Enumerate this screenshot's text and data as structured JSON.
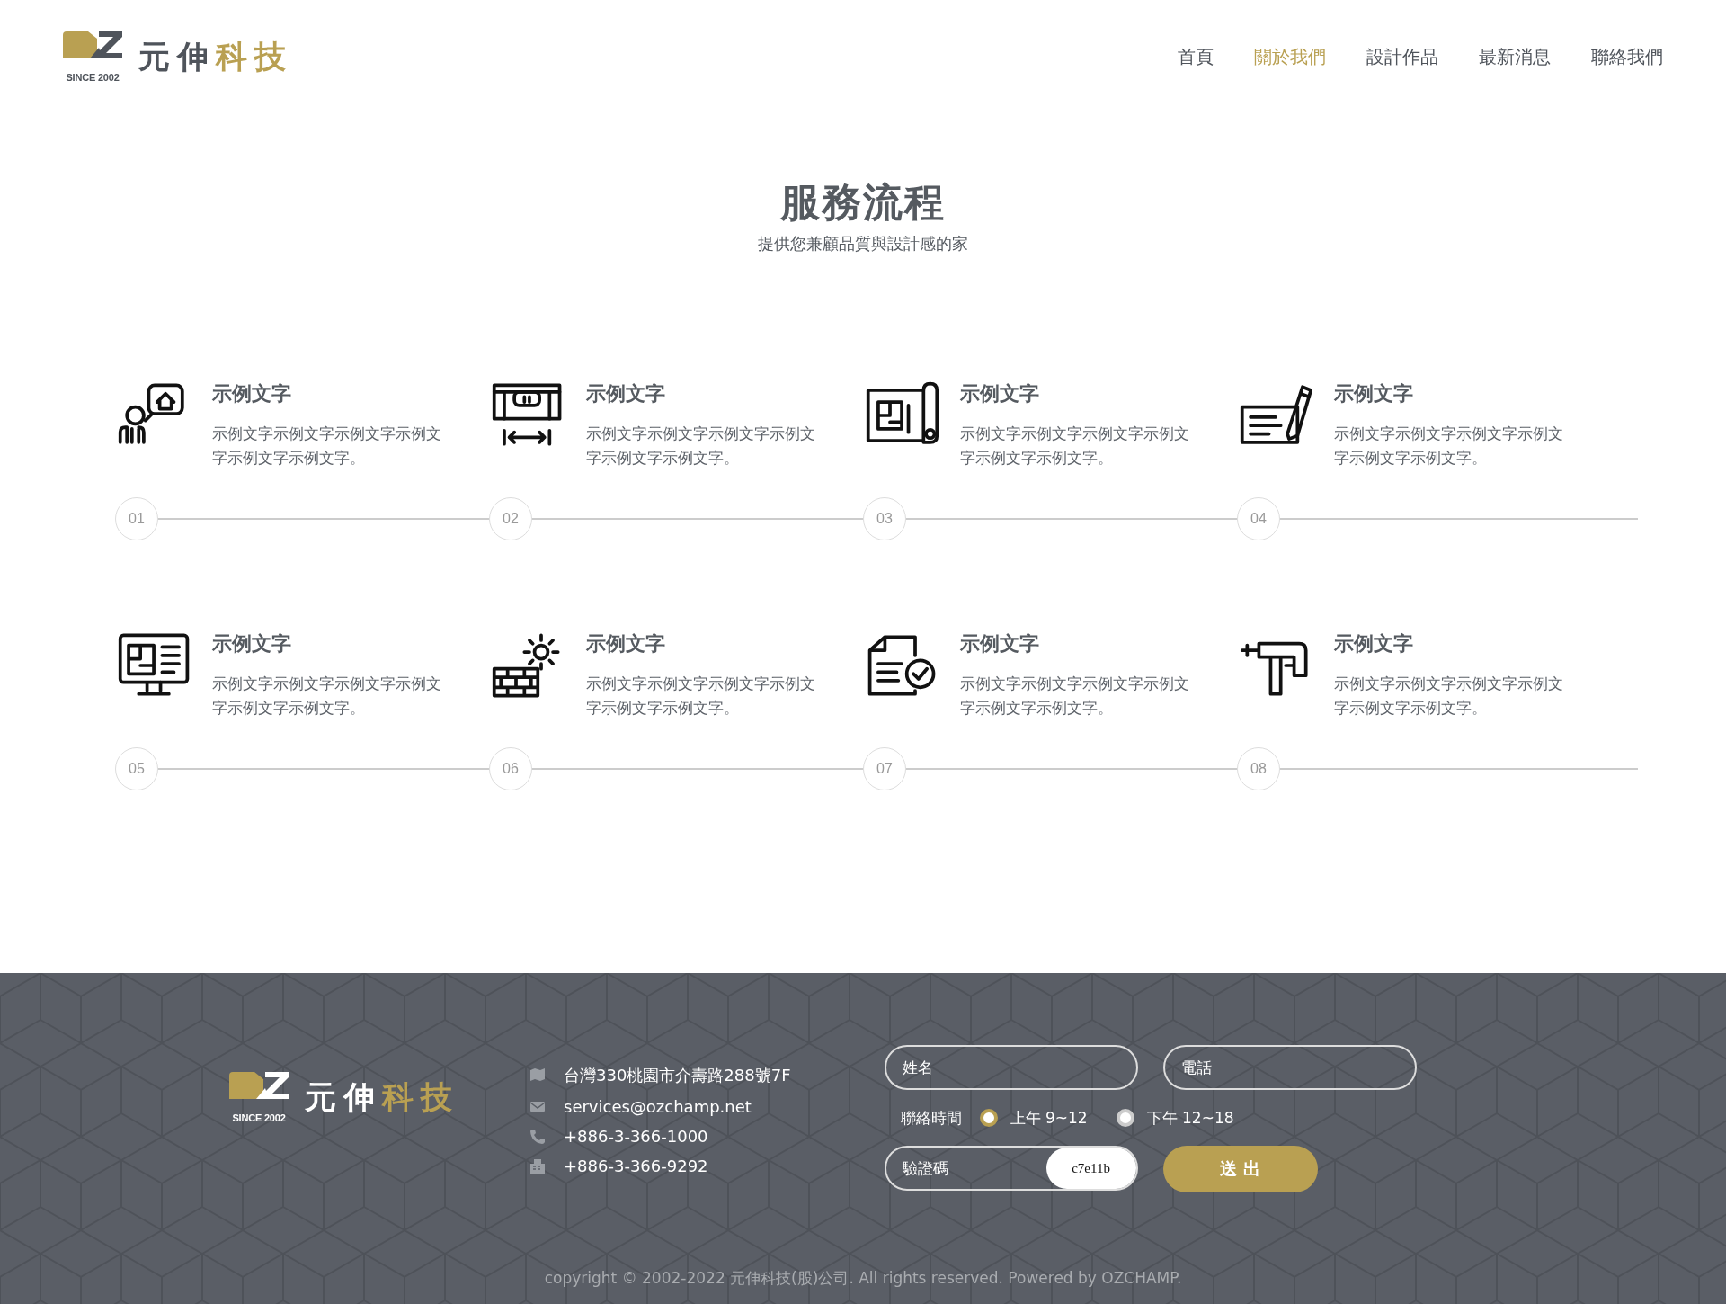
{
  "header": {
    "logo": {
      "since": "SINCE 2002",
      "brand_dark": "元伸",
      "brand_gold": "科技"
    },
    "nav": [
      {
        "label": "首頁",
        "selected": false
      },
      {
        "label": "關於我們",
        "selected": true
      },
      {
        "label": "設計作品",
        "selected": false
      },
      {
        "label": "最新消息",
        "selected": false
      },
      {
        "label": "聯絡我們",
        "selected": false
      }
    ]
  },
  "section": {
    "title": "服務流程",
    "subtitle": "提供您兼顧品質與設計感的家"
  },
  "steps": [
    {
      "kind": "consult",
      "title": "示例文字",
      "text": "示例文字示例文字示例文字示例文字示例文字示例文字。",
      "number": "01"
    },
    {
      "kind": "level",
      "title": "示例文字",
      "text": "示例文字示例文字示例文字示例文字示例文字示例文字。",
      "number": "02"
    },
    {
      "kind": "blueprint",
      "title": "示例文字",
      "text": "示例文字示例文字示例文字示例文字示例文字示例文字。",
      "number": "03"
    },
    {
      "kind": "contract",
      "title": "示例文字",
      "text": "示例文字示例文字示例文字示例文字示例文字示例文字。",
      "number": "04"
    },
    {
      "kind": "monitor",
      "title": "示例文字",
      "text": "示例文字示例文字示例文字示例文字示例文字示例文字。",
      "number": "05"
    },
    {
      "kind": "build",
      "title": "示例文字",
      "text": "示例文字示例文字示例文字示例文字示例文字示例文字。",
      "number": "06"
    },
    {
      "kind": "check",
      "title": "示例文字",
      "text": "示例文字示例文字示例文字示例文字示例文字示例文字。",
      "number": "07"
    },
    {
      "kind": "drill",
      "title": "示例文字",
      "text": "示例文字示例文字示例文字示例文字示例文字示例文字。",
      "number": "08"
    }
  ],
  "footer": {
    "logo": {
      "since": "SINCE 2002",
      "brand_dark": "元伸",
      "brand_gold": "科技"
    },
    "contacts": [
      {
        "kind": "map",
        "text": "台灣330桃園市介壽路288號7F"
      },
      {
        "kind": "mail",
        "text": "services@ozchamp.net"
      },
      {
        "kind": "phone",
        "text": "+886-3-366-1000"
      },
      {
        "kind": "fax",
        "text": "+886-3-366-9292"
      }
    ],
    "form": {
      "name": {
        "placeholder": "姓名"
      },
      "phone": {
        "placeholder": "電話"
      },
      "time_label": "聯絡時間",
      "times": [
        {
          "label": "上午 9~12",
          "selected": true
        },
        {
          "label": "下午 12~18",
          "selected": false
        }
      ],
      "captcha": {
        "placeholder": "驗證碼",
        "code": "c7e11b"
      },
      "submit": "送 出"
    },
    "copyright": "copyright © 2002-2022 元伸科技(股)公司. All rights reserved. Powered by OZCHAMP."
  }
}
